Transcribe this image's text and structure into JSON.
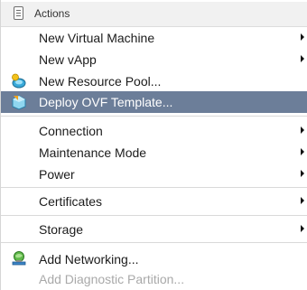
{
  "menu": {
    "title": "Actions",
    "title_icon": "clipboard-icon",
    "items": [
      {
        "label": "New Virtual Machine",
        "has_submenu": true
      },
      {
        "label": "New vApp",
        "has_submenu": true
      },
      {
        "label": "New Resource Pool...",
        "icon": "resource-pool-icon"
      },
      {
        "label": "Deploy OVF Template...",
        "icon": "deploy-ovf-icon",
        "selected": true
      },
      {
        "label": "Connection",
        "has_submenu": true
      },
      {
        "label": "Maintenance Mode",
        "has_submenu": true
      },
      {
        "label": "Power",
        "has_submenu": true
      },
      {
        "label": "Certificates",
        "has_submenu": true
      },
      {
        "label": "Storage",
        "has_submenu": true
      },
      {
        "label": "Add Networking...",
        "icon": "add-networking-icon"
      },
      {
        "label": "Add Diagnostic Partition...",
        "disabled": true
      }
    ]
  },
  "colors": {
    "selected_background": "#6c7e99",
    "header_background": "#f1f1f1",
    "disabled_text": "#a9a9a9"
  }
}
